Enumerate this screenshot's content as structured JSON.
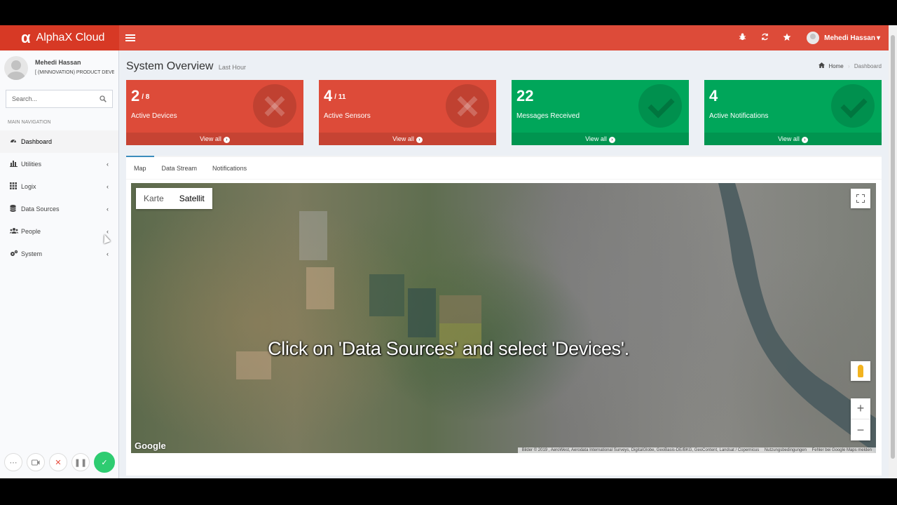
{
  "header": {
    "brand_symbol": "α",
    "brand_name": "AlphaX Cloud",
    "user_name": "Mehedi Hassan",
    "user_caret": "▾"
  },
  "sidebar": {
    "user_name": "Mehedi Hassan",
    "user_org": "[ (MINNOVATION) PRODUCT DEVELOPMENT ]",
    "search_placeholder": "Search...",
    "nav_header": "MAIN NAVIGATION",
    "items": [
      {
        "label": "Dashboard",
        "icon": "dashboard-icon"
      },
      {
        "label": "Utilities",
        "icon": "chart-icon"
      },
      {
        "label": "Logix",
        "icon": "grid-icon"
      },
      {
        "label": "Data Sources",
        "icon": "database-icon"
      },
      {
        "label": "People",
        "icon": "users-icon"
      },
      {
        "label": "System",
        "icon": "cogs-icon"
      }
    ]
  },
  "content": {
    "title": "System Overview",
    "title_small": "Last Hour",
    "breadcrumb_home": "Home",
    "breadcrumb_current": "Dashboard"
  },
  "stat_boxes": [
    {
      "value": "2",
      "total": "/ 8",
      "label": "Active Devices",
      "footer": "View all",
      "status": "red"
    },
    {
      "value": "4",
      "total": "/ 11",
      "label": "Active Sensors",
      "footer": "View all",
      "status": "red"
    },
    {
      "value": "22",
      "total": "",
      "label": "Messages Received",
      "footer": "View all",
      "status": "green"
    },
    {
      "value": "4",
      "total": "",
      "label": "Active Notifications",
      "footer": "View all",
      "status": "green"
    }
  ],
  "tabs": [
    "Map",
    "Data Stream",
    "Notifications"
  ],
  "map": {
    "type_map": "Karte",
    "type_satellite": "Satellit",
    "selected_type": "Satellit",
    "logo": "Google",
    "attribution": "Bilder © 2019 , AeroWest, Aerodata International Surveys, DigitalGlobe, GeoBasis-DE/BKG, GeoContent, Landsat / Copernicus",
    "terms": "Nutzungsbedingungen",
    "report": "Fehler bei Google Maps melden"
  },
  "caption": "Click on 'Data Sources' and select 'Devices'.",
  "colors": {
    "header": "#dd4b39",
    "danger": "#dd4b39",
    "success": "#00a65a",
    "accent": "#3c8dbc"
  }
}
